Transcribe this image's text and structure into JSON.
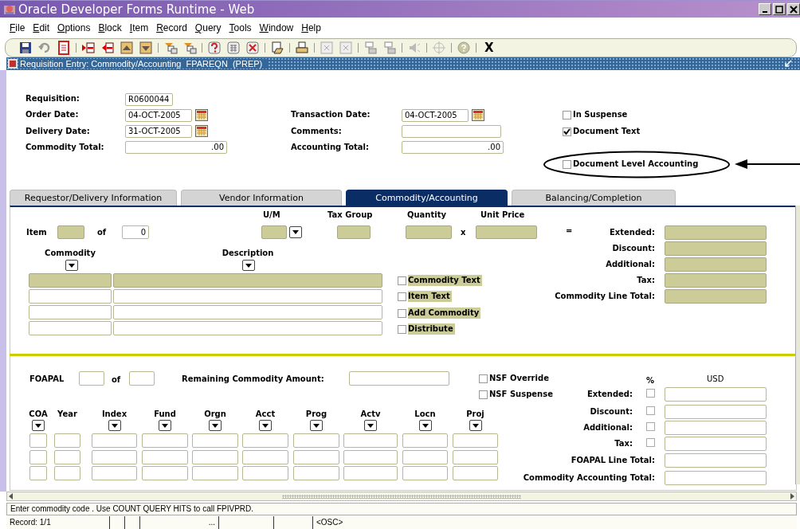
{
  "window": {
    "title": "Oracle Developer Forms Runtime - Web"
  },
  "menu": [
    "File",
    "Edit",
    "Options",
    "Block",
    "Item",
    "Record",
    "Query",
    "Tools",
    "Window",
    "Help"
  ],
  "toolbar": {
    "exit_label": "X"
  },
  "form": {
    "title": "Requisition Entry: Commodity/Accounting  FPAREQN  (PREP)"
  },
  "header": {
    "fields": [
      {
        "label": "Requisition:",
        "value": "R0600044",
        "kind": "text"
      },
      {
        "label": "Order Date:",
        "value": "04-OCT-2005",
        "kind": "date"
      },
      {
        "label": "Delivery Date:",
        "value": "31-OCT-2005",
        "kind": "date"
      },
      {
        "label": "Commodity Total:",
        "value": ".00",
        "kind": "amount"
      },
      {
        "label": "Transaction Date:",
        "value": "04-OCT-2005",
        "kind": "date"
      },
      {
        "label": "Comments:",
        "kind": "text"
      },
      {
        "label": "Accounting Total:",
        "value": ".00",
        "kind": "amount"
      }
    ],
    "checkboxes": [
      {
        "label": "In Suspense",
        "checked": false
      },
      {
        "label": "Document Text",
        "checked": true
      },
      {
        "label": "Document Level Accounting",
        "checked": false
      }
    ]
  },
  "tabs": [
    {
      "label": "Requestor/Delivery Information",
      "selected": false
    },
    {
      "label": "Vendor Information",
      "selected": false
    },
    {
      "label": "Commodity/Accounting",
      "selected": true
    },
    {
      "label": "Balancing/Completion",
      "selected": false
    }
  ],
  "commodity": {
    "item_label": "Item",
    "of_label": "of",
    "of_value": "0",
    "headings": [
      "U/M",
      "Tax Group",
      "Quantity",
      "Unit Price"
    ],
    "times": "x",
    "equals": "=",
    "totals": [
      "Extended:",
      "Discount:",
      "Additional:",
      "Tax:",
      "Commodity Line Total:"
    ],
    "columns": [
      {
        "label": "Commodity",
        "lookup": true
      },
      {
        "label": "Description",
        "lookup": true
      }
    ],
    "rows": [
      {
        "selected": true
      },
      {
        "selected": false
      },
      {
        "selected": false
      },
      {
        "selected": false
      }
    ],
    "options": [
      {
        "label": "Commodity Text",
        "checked": false
      },
      {
        "label": "Item Text",
        "checked": false
      },
      {
        "label": "Add Commodity",
        "checked": false
      },
      {
        "label": "Distribute",
        "checked": false
      }
    ]
  },
  "accounting": {
    "foapal_label": "FOAPAL",
    "of_label": "of",
    "remaining_label": "Remaining Commodity Amount:",
    "options": [
      {
        "label": "NSF Override",
        "checked": false
      },
      {
        "label": "NSF Suspense",
        "checked": false
      }
    ],
    "percent_label": "%",
    "currency": "USD",
    "amounts": [
      {
        "label": "Extended:",
        "percent": false
      },
      {
        "label": "Discount:",
        "percent": false
      },
      {
        "label": "Additional:",
        "percent": false
      },
      {
        "label": "Tax:",
        "percent": false
      }
    ],
    "totals": [
      "FOAPAL Line Total:",
      "Commodity Accounting Total:"
    ],
    "columns": [
      {
        "label": "COA",
        "lookup": true
      },
      {
        "label": "Year",
        "lookup": false
      },
      {
        "label": "Index",
        "lookup": true
      },
      {
        "label": "Fund",
        "lookup": true
      },
      {
        "label": "Orgn",
        "lookup": true
      },
      {
        "label": "Acct",
        "lookup": true
      },
      {
        "label": "Prog",
        "lookup": true
      },
      {
        "label": "Actv",
        "lookup": true
      },
      {
        "label": "Locn",
        "lookup": true
      },
      {
        "label": "Proj",
        "lookup": true
      }
    ]
  },
  "status": {
    "message": "Enter commodity code . Use COUNT QUERY HITS to call FPIVPRD.",
    "record": "Record: 1/1",
    "cells": [
      "",
      "",
      "...",
      "",
      "",
      "<OSC>"
    ]
  }
}
